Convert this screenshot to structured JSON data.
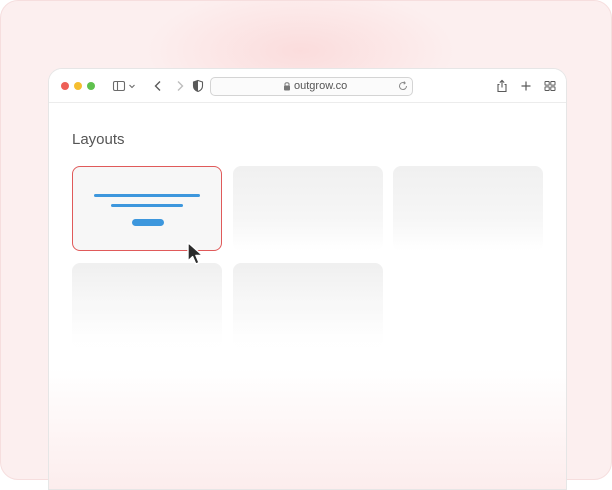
{
  "browser": {
    "url": "outgrow.co",
    "colors": {
      "close": "#ee5f57",
      "minimize": "#f5be2f",
      "zoom": "#5fc14e"
    },
    "icons": [
      "sidebar-icon",
      "chevron-down-icon",
      "back-icon",
      "forward-icon",
      "shield-icon",
      "lock-icon",
      "reload-icon",
      "share-icon",
      "new-tab-icon",
      "tab-overview-icon"
    ]
  },
  "page": {
    "title": "Layouts",
    "accent": "#3d97dd",
    "selected_border": "#e05a5a",
    "layouts": [
      {
        "state": "selected"
      },
      {
        "state": "placeholder"
      },
      {
        "state": "placeholder"
      },
      {
        "state": "placeholder"
      },
      {
        "state": "placeholder"
      }
    ]
  }
}
